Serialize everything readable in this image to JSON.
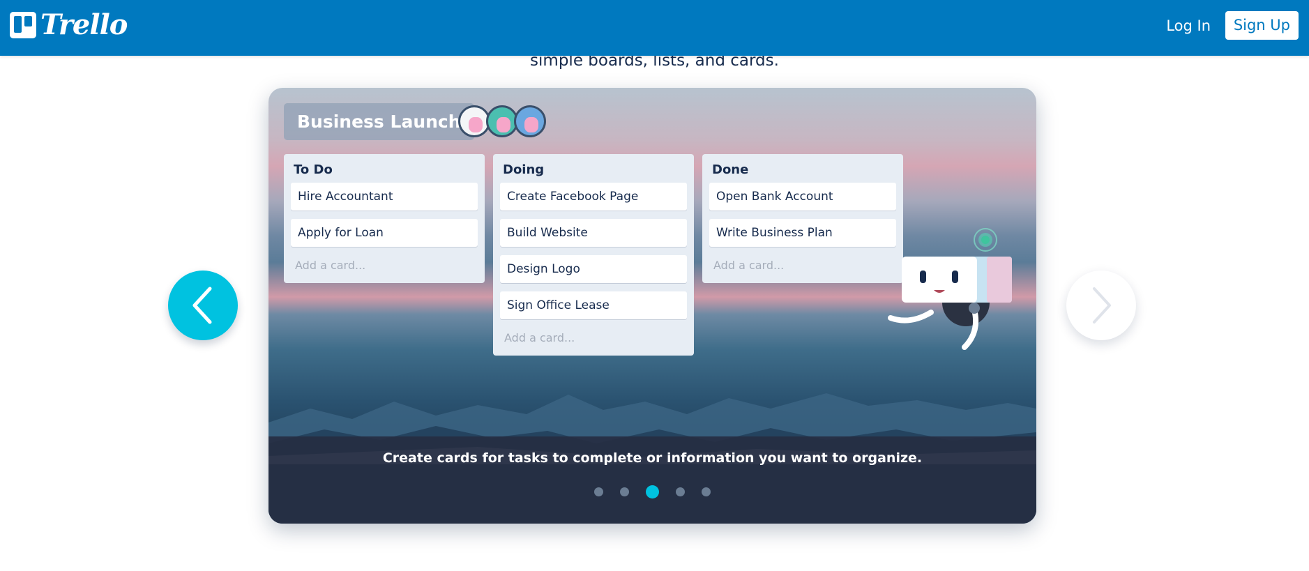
{
  "header": {
    "brand": "Trello",
    "login_label": "Log In",
    "signup_label": "Sign Up",
    "brand_color": "#0079bf"
  },
  "hero": {
    "subtitle": "simple boards, lists, and cards."
  },
  "board": {
    "title": "Business Launch",
    "members": [
      "member-1",
      "member-2",
      "member-3"
    ],
    "lists": [
      {
        "title": "To Do",
        "cards": [
          "Hire Accountant",
          "Apply for Loan"
        ],
        "add_card": "Add a card..."
      },
      {
        "title": "Doing",
        "cards": [
          "Create Facebook Page",
          "Build Website",
          "Design Logo",
          "Sign Office Lease"
        ],
        "add_card": "Add a card..."
      },
      {
        "title": "Done",
        "cards": [
          "Open Bank Account",
          "Write Business Plan"
        ],
        "add_card": "Add a card..."
      }
    ]
  },
  "carousel": {
    "caption": "Create cards for tasks to complete or information you want to organize.",
    "slide_count": 5,
    "active_slide": 3,
    "active_color": "#00c2e0",
    "prev_icon": "chevron-left-icon",
    "next_icon": "chevron-right-icon"
  }
}
